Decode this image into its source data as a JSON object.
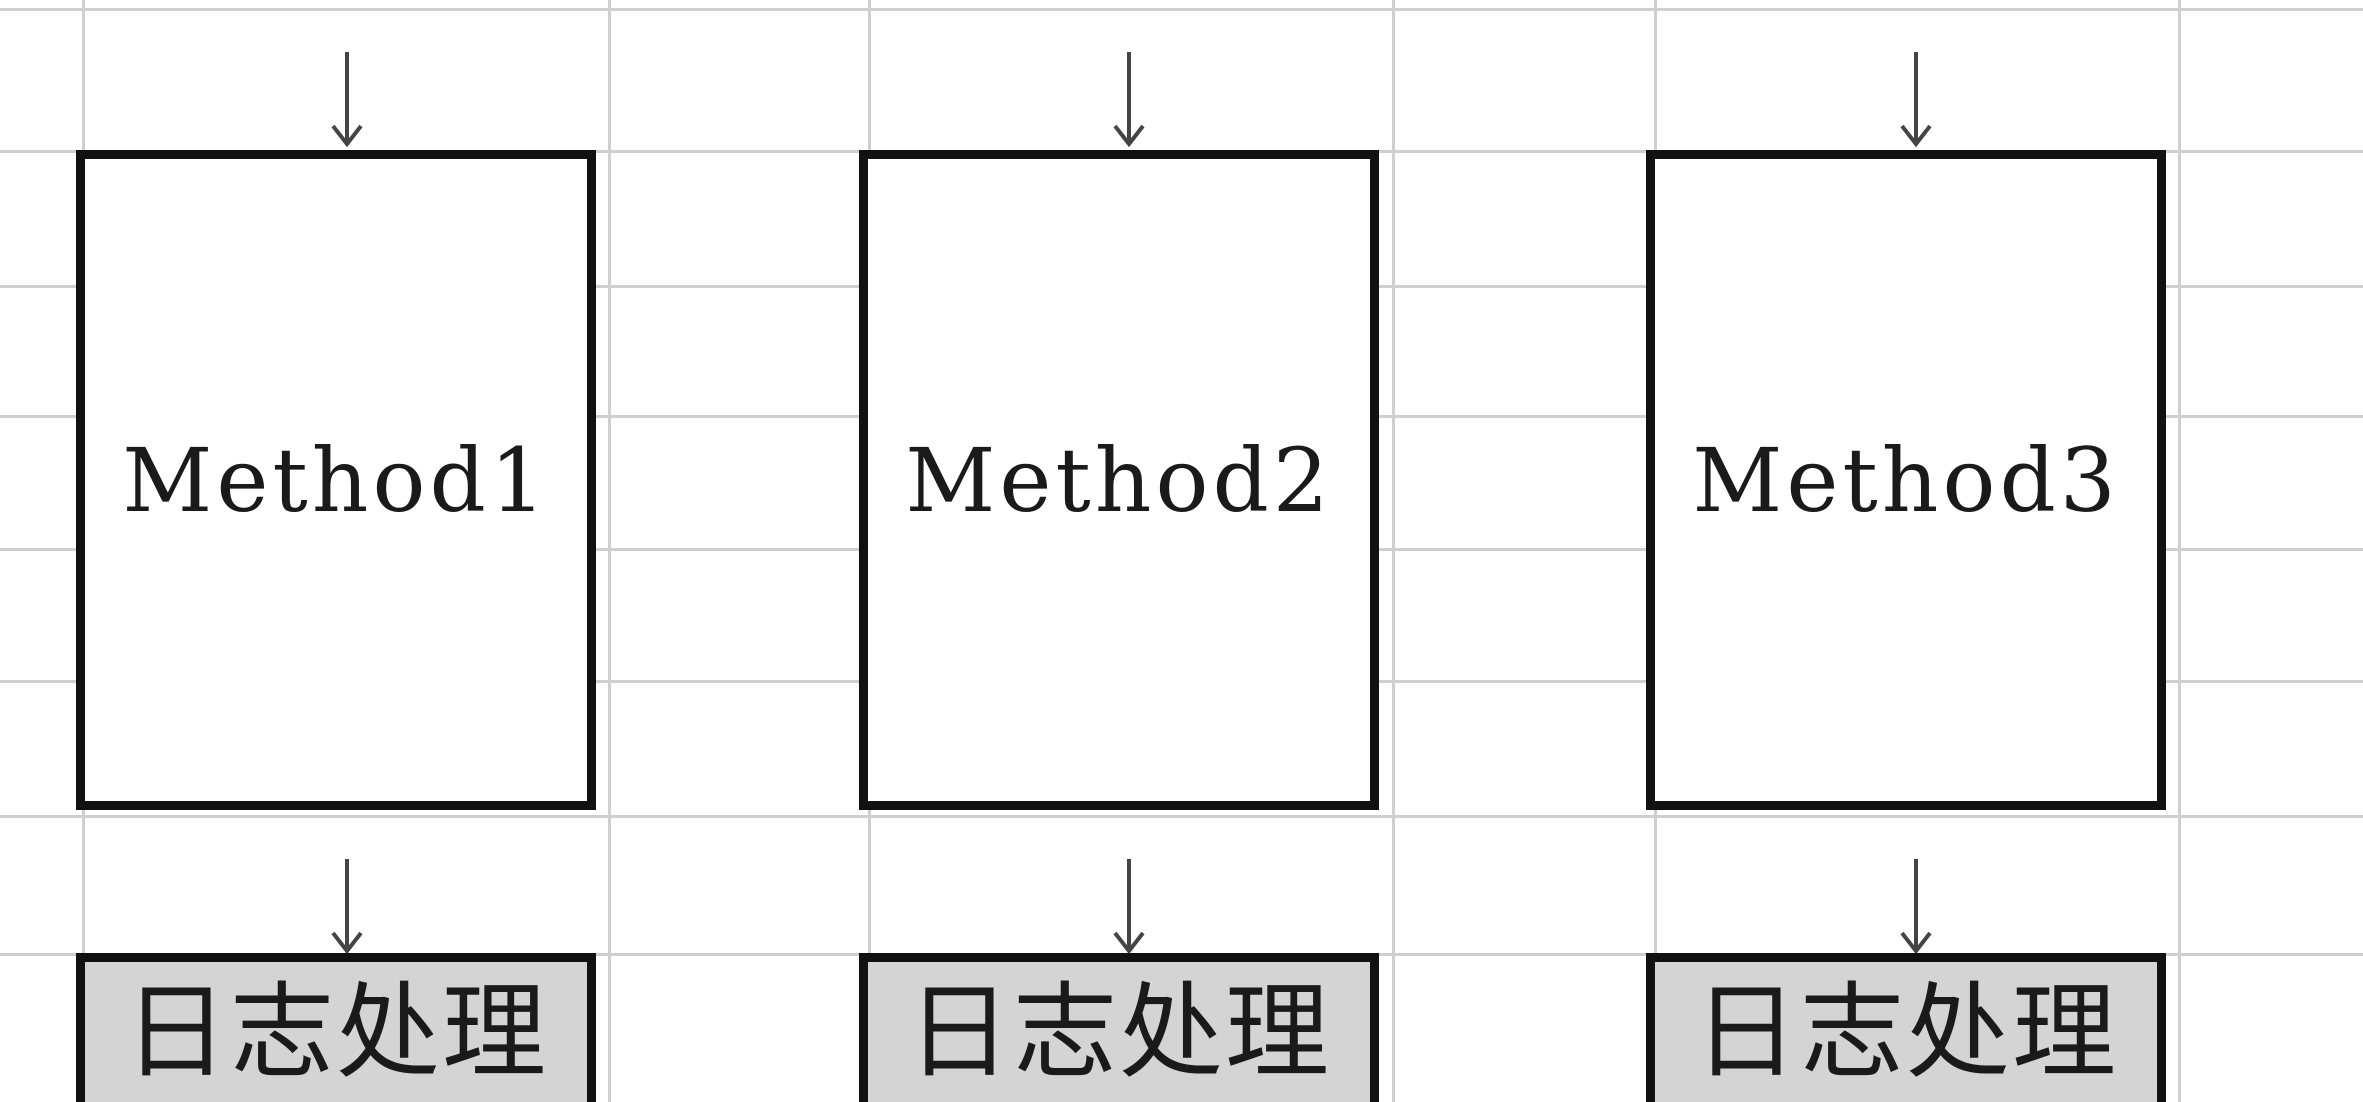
{
  "colors": {
    "background": "#ffffff",
    "gridline": "#cfcfcf",
    "box_border": "#111111",
    "log_fill": "#d4d4d4",
    "text": "#1a1a1a"
  },
  "methods": [
    {
      "label": "Method1",
      "log_label": "日志处理"
    },
    {
      "label": "Method2",
      "log_label": "日志处理"
    },
    {
      "label": "Method3",
      "log_label": "日志处理"
    }
  ]
}
